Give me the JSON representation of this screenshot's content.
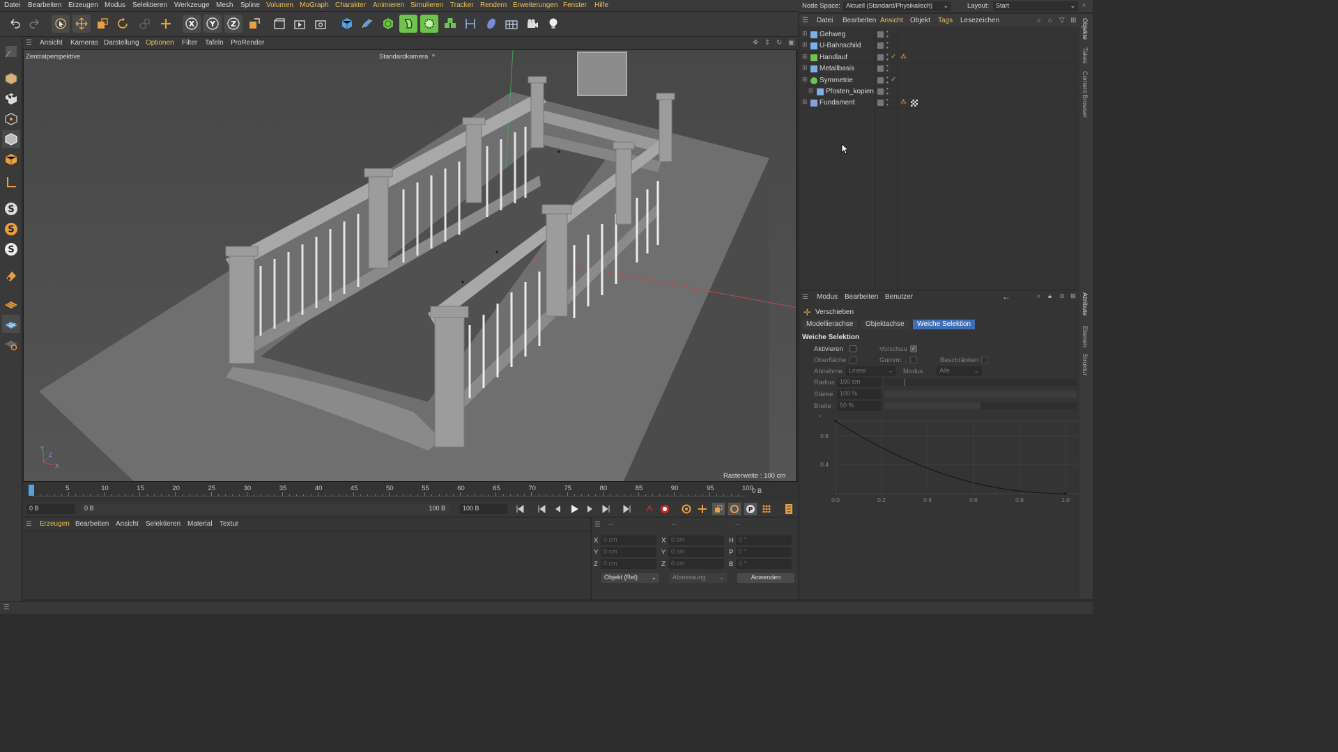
{
  "menu": [
    "Datei",
    "Bearbeiten",
    "Erzeugen",
    "Modus",
    "Selektieren",
    "Werkzeuge",
    "Mesh",
    "Spline",
    "Volumen",
    "MoGraph",
    "Charakter",
    "Animieren",
    "Simulieren",
    "Tracker",
    "Rendern",
    "Erweiterungen",
    "Fenster",
    "Hilfe"
  ],
  "node_space": {
    "label": "Node Space:",
    "value": "Aktuell (Standard/Physikalisch)",
    "layout_label": "Layout:",
    "layout_value": "Start"
  },
  "toolbar": {
    "axis_x": "X",
    "axis_y": "Y",
    "axis_z": "Z"
  },
  "viewport_menu": [
    "Ansicht",
    "Kameras",
    "Darstellung",
    "Optionen",
    "Filter",
    "Tafeln",
    "ProRender"
  ],
  "viewport": {
    "perspective": "Zentralperspektive",
    "camera": "Standardkamera",
    "grid": "Rasterweite : 100 cm",
    "axis_y": "Y",
    "axis_z": "Z",
    "axis_x": "X"
  },
  "timeline": {
    "ticks": [
      "0",
      "5",
      "10",
      "15",
      "20",
      "25",
      "30",
      "35",
      "40",
      "45",
      "50",
      "55",
      "60",
      "65",
      "70",
      "75",
      "80",
      "85",
      "90",
      "95",
      "100"
    ],
    "current_frame": "0 B"
  },
  "transport": {
    "start": "0 B",
    "range_start": "0 B",
    "range_end": "100 B",
    "end": "100 B"
  },
  "material_menu": [
    "Erzeugen",
    "Bearbeiten",
    "Ansicht",
    "Selektieren",
    "Material",
    "Textur"
  ],
  "coords": {
    "header": [
      "--",
      "--",
      "--"
    ],
    "rows": [
      {
        "a": "X",
        "av": "0 cm",
        "b": "X",
        "bv": "0 cm",
        "c": "H",
        "cv": "0 °"
      },
      {
        "a": "Y",
        "av": "0 cm",
        "b": "Y",
        "bv": "0 cm",
        "c": "P",
        "cv": "0 °"
      },
      {
        "a": "Z",
        "av": "0 cm",
        "b": "Z",
        "bv": "0 cm",
        "c": "B",
        "cv": "0 °"
      }
    ],
    "mode": "Objekt (Rel)",
    "size": "Abmessung",
    "apply": "Anwenden"
  },
  "objects": {
    "menu": [
      "Datei",
      "Bearbeiten",
      "Ansicht",
      "Objekt",
      "Tags",
      "Lesezeichen"
    ],
    "items": [
      {
        "name": "Gehweg"
      },
      {
        "name": "U-Bahnschild"
      },
      {
        "name": "Handlauf"
      },
      {
        "name": "Metallbasis"
      },
      {
        "name": "Symmetrie"
      },
      {
        "name": "Pfosten_kopien"
      },
      {
        "name": "Fundament"
      }
    ]
  },
  "attributes": {
    "menu": [
      "Modus",
      "Bearbeiten",
      "Benutzer"
    ],
    "tool": "Verschieben",
    "tabs": [
      "Modellierachse",
      "Objektachse",
      "Weiche Selektion"
    ],
    "section": "Weiche Selektion",
    "activate": "Aktivieren",
    "preview": "Vorschau",
    "surface": "Oberfläche",
    "rubber": "Gummi. .",
    "restrict": "Beschränken",
    "falloff_label": "Abnahme",
    "falloff_value": "Linear",
    "mode_label": "Modus",
    "mode_value": "Alle",
    "radius_label": "Radius",
    "radius_value": "100 cm",
    "strength_label": "Stärke",
    "strength_value": "100 %",
    "width_label": "Breite",
    "width_value": "50 %",
    "graph_y": [
      "0.8",
      "0.4"
    ],
    "graph_x": [
      "0.0",
      "0.2",
      "0.4",
      "0.6",
      "0.8",
      "1.0"
    ]
  },
  "side_tabs": [
    "Objekte",
    "Takes",
    "Content Browser",
    "Attribute",
    "Ebenen",
    "Struktur"
  ],
  "colors": {
    "accent": "#e8c25a",
    "selected_tab": "#3e6eb6",
    "green": "#6fc24d"
  }
}
